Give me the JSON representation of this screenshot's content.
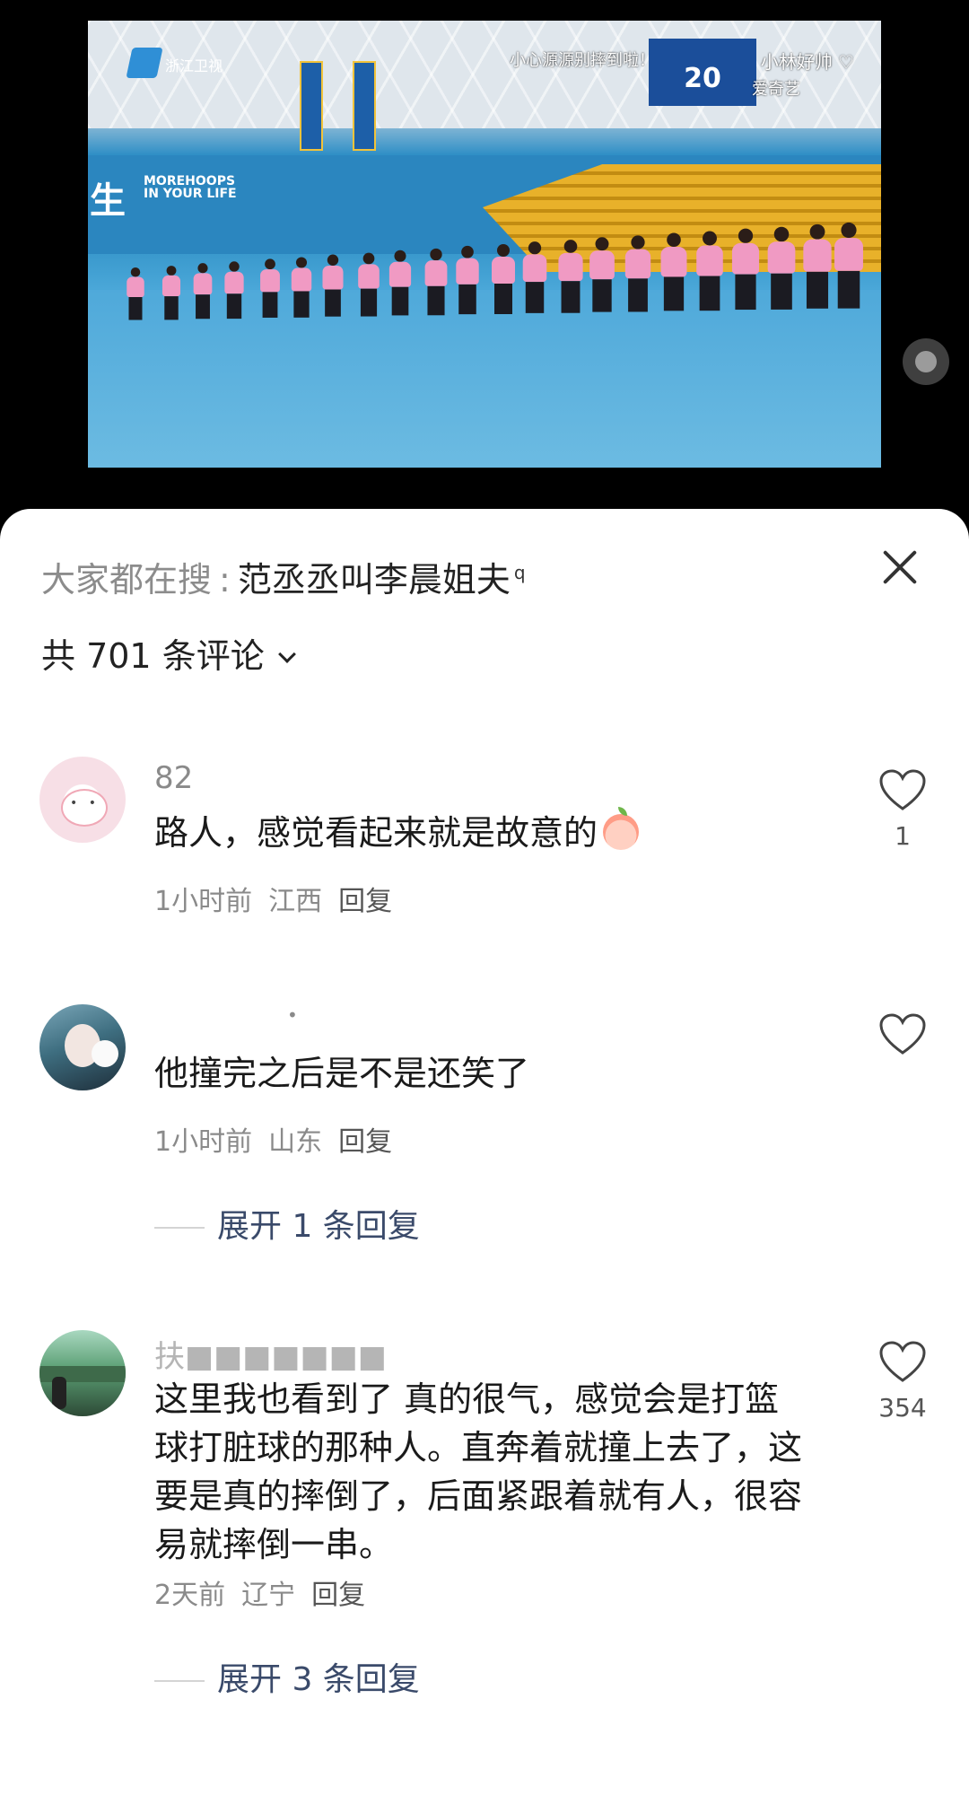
{
  "video": {
    "overlay_center": "小心源源别摔到啦！",
    "overlay_right": "小林好帅 ♡",
    "station_logo_text": "浙江卫视",
    "iqiyi_text": "爱奇艺",
    "scoreboard_text": "20",
    "ad_text_line1": "MOREHOOPS",
    "ad_text_line2": "IN YOUR LIFE",
    "ad_big_char": "生"
  },
  "search": {
    "prefix": "大家都在搜",
    "separator": ":",
    "query": "范丞丞叫李晨姐夫",
    "suffix_icon": "q"
  },
  "comments_header": {
    "count_text": "共 701 条评论"
  },
  "comments": [
    {
      "username": "82",
      "text": "路人，感觉看起来就是故意的",
      "emoji_icon": "peach-emoji-icon",
      "time": "1小时前",
      "location": "江西",
      "reply": "回复",
      "likes": "1"
    },
    {
      "username": "•",
      "text": "他撞完之后是不是还笑了",
      "time": "1小时前",
      "location": "山东",
      "reply": "回复",
      "likes": "",
      "expand": "展开 1 条回复"
    },
    {
      "username": "扶■■■■■■■",
      "text": "这里我也看到了 真的很气，感觉会是打篮球打脏球的那种人。直奔着就撞上去了，这要是真的摔倒了，后面紧跟着就有人，很容易就摔倒一串。",
      "time": "2天前",
      "location": "辽宁",
      "reply": "回复",
      "likes": "354",
      "expand": "展开 3 条回复"
    }
  ]
}
